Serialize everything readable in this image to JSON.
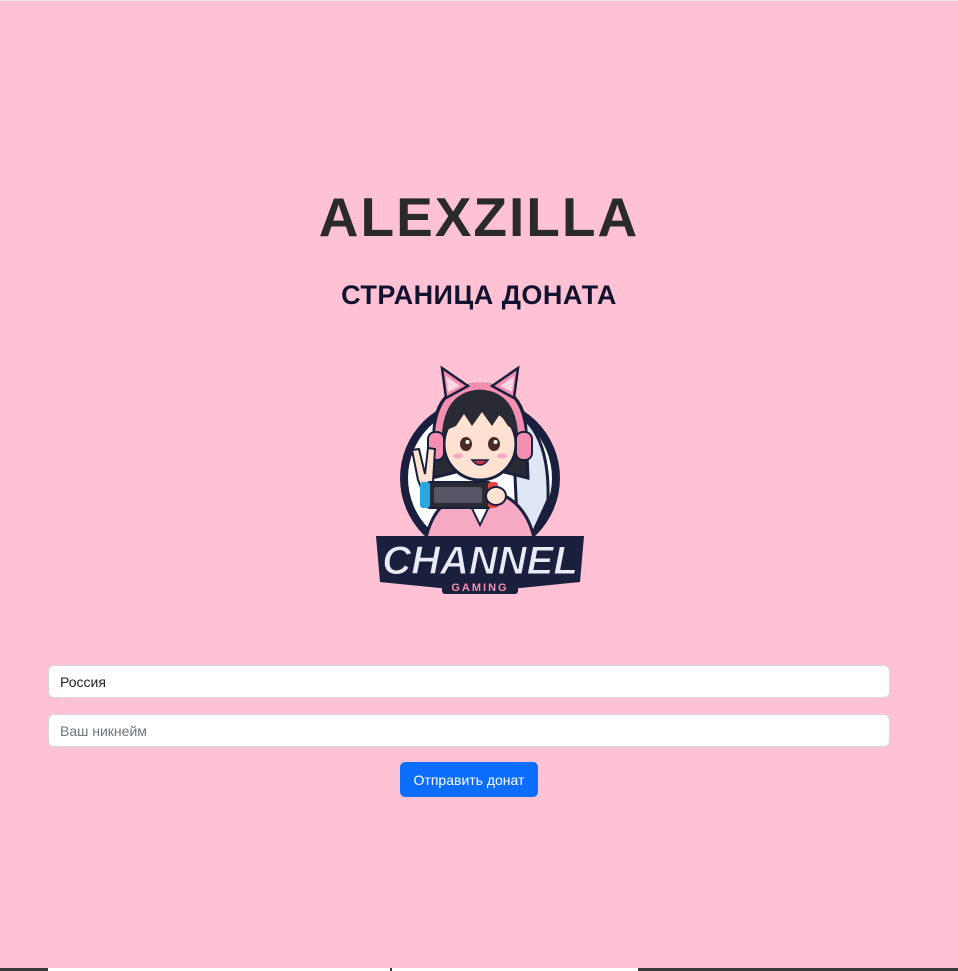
{
  "header": {
    "title": "ALEXZILLA",
    "subtitle": "СТРАНИЦА ДОНАТА"
  },
  "logo": {
    "text": "CHANNEL",
    "subtext": "GAMING",
    "icon": "gamer-girl-mascot-icon"
  },
  "form": {
    "country_value": "Россия",
    "nickname_placeholder": "Ваш никнейм",
    "nickname_value": "",
    "submit_label": "Отправить донат"
  },
  "colors": {
    "background": "#ffc2d5",
    "title": "#2a2a2a",
    "subtitle": "#12122e",
    "button": "#0d6efd",
    "logo_pink": "#f48fb1",
    "logo_navy": "#1a1f3d"
  }
}
